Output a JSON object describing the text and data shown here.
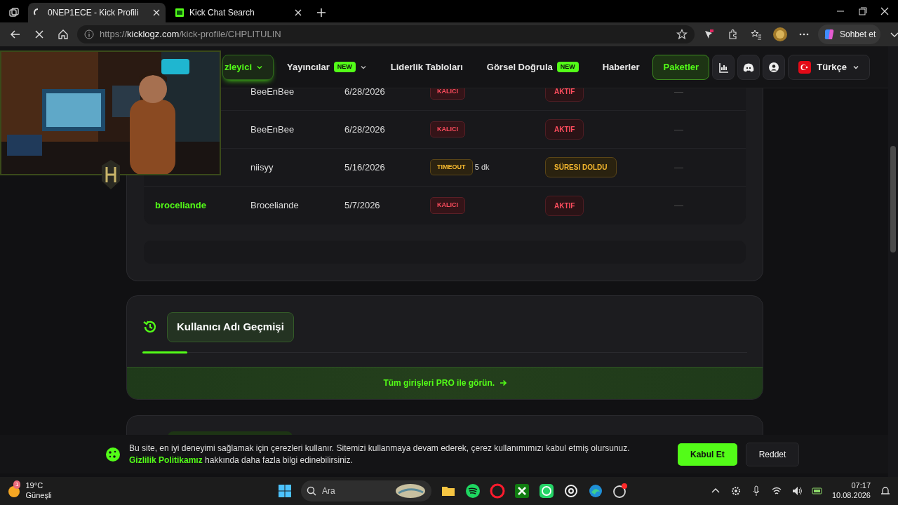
{
  "browser": {
    "tabs": [
      {
        "title": "0NEP1ECE - Kick Profili",
        "selected": true,
        "loading": true
      },
      {
        "title": "Kick Chat Search",
        "selected": false,
        "loading": false
      }
    ],
    "url_scheme": "https://",
    "url_domain": "kicklogz.com",
    "url_path": "/kick-profile/CHPLITULIN",
    "copilot_label": "Sohbet et"
  },
  "nav": {
    "items": [
      {
        "label": "zleyici",
        "kind": "dropdown",
        "selected": true
      },
      {
        "label": "Yayıncılar",
        "kind": "dropdown",
        "badge": "NEW",
        "selected": false
      },
      {
        "label": "Liderlik Tabloları",
        "kind": "link",
        "selected": false
      },
      {
        "label": "Görsel Doğrula",
        "kind": "link",
        "badge": "NEW",
        "selected": false
      },
      {
        "label": "Haberler",
        "kind": "link",
        "selected": false
      },
      {
        "label": "Paketler",
        "kind": "cta",
        "selected": false
      }
    ],
    "language": "Türkçe"
  },
  "bans": {
    "rows": [
      {
        "channel": "BeeEnBee",
        "date": "6/28/2026",
        "type": {
          "text": "KALICI",
          "kind": "permanent"
        },
        "status": {
          "text": "AKTIF",
          "kind": "active"
        },
        "column_6": "—"
      },
      {
        "channel": "BeeEnBee",
        "date": "6/28/2026",
        "type": {
          "text": "KALICI",
          "kind": "permanent"
        },
        "status": {
          "text": "AKTIF",
          "kind": "active"
        },
        "column_6": "—"
      },
      {
        "channel": "niisyy",
        "date": "5/16/2026",
        "type": {
          "text": "TIMEOUT",
          "kind": "timeout"
        },
        "duration": "5 dk",
        "status": {
          "text": "SÜRESI DOLDU",
          "kind": "expired"
        },
        "column_6": "—"
      },
      {
        "username": "broceliande",
        "channel": "Broceliande",
        "date": "5/7/2026",
        "type": {
          "text": "KALICI",
          "kind": "permanent"
        },
        "status": {
          "text": "AKTIF",
          "kind": "active"
        },
        "column_6": "—"
      }
    ]
  },
  "username_history": {
    "title": "Kullanıcı Adı Geçmişi",
    "pro_link": "Tüm girişleri PRO ile görün."
  },
  "cookie_banner": {
    "text_before": "Bu site, en iyi deneyimi sağlamak için çerezleri kullanır. Sitemizi kullanmaya devam ederek, çerez kullanımımızı kabul etmiş olursunuz.",
    "link": "Gizlilik Politikamız",
    "text_after": "hakkında daha fazla bilgi edinebilirsiniz.",
    "accept": "Kabul Et",
    "reject": "Reddet"
  },
  "taskbar": {
    "weather_badge": "1",
    "temperature": "19°C",
    "condition": "Güneşli",
    "search_placeholder": "Ara",
    "time": "07:17",
    "date": "10.08.2026"
  }
}
